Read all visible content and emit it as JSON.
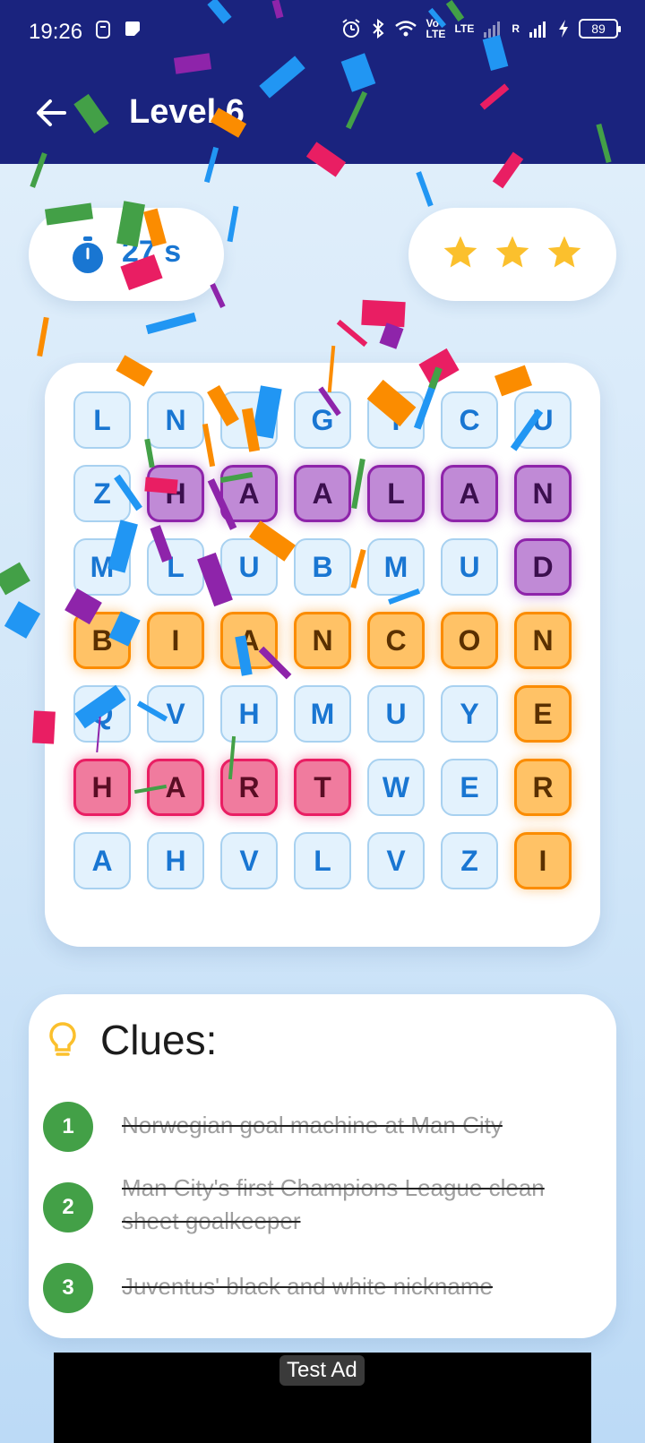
{
  "status_bar": {
    "time": "19:26",
    "network_label_1": "Vo LTE",
    "network_label_2": "LTE",
    "signal_label": "R",
    "battery": "89"
  },
  "header": {
    "title": "Level 6",
    "back_icon": "arrow-left-icon"
  },
  "timer": {
    "value": "27 s",
    "icon": "stopwatch-icon"
  },
  "rating": {
    "stars_earned": 3,
    "stars_total": 3,
    "star_color": "#fbc02d"
  },
  "grid": {
    "rows": [
      [
        "L",
        "N",
        "I",
        "G",
        "I",
        "C",
        "U"
      ],
      [
        "Z",
        "H",
        "A",
        "A",
        "L",
        "A",
        "N"
      ],
      [
        "M",
        "L",
        "U",
        "B",
        "M",
        "U",
        "D"
      ],
      [
        "B",
        "I",
        "A",
        "N",
        "C",
        "O",
        "N"
      ],
      [
        "Q",
        "V",
        "H",
        "M",
        "U",
        "Y",
        "E"
      ],
      [
        "H",
        "A",
        "R",
        "T",
        "W",
        "E",
        "R"
      ],
      [
        "A",
        "H",
        "V",
        "L",
        "V",
        "Z",
        "I"
      ]
    ],
    "highlights": [
      [
        "plain",
        "plain",
        "plain",
        "plain",
        "plain",
        "plain",
        "plain"
      ],
      [
        "plain",
        "purple",
        "purple",
        "purple",
        "purple",
        "purple",
        "purple"
      ],
      [
        "plain",
        "plain",
        "plain",
        "plain",
        "plain",
        "plain",
        "purple"
      ],
      [
        "orange",
        "orange",
        "orange",
        "orange",
        "orange",
        "orange",
        "orange"
      ],
      [
        "plain",
        "plain",
        "plain",
        "plain",
        "plain",
        "plain",
        "orange"
      ],
      [
        "pink",
        "pink",
        "pink",
        "pink",
        "plain",
        "plain",
        "orange"
      ],
      [
        "plain",
        "plain",
        "plain",
        "plain",
        "plain",
        "plain",
        "orange"
      ]
    ]
  },
  "clues": {
    "title": "Clues:",
    "icon": "lightbulb-icon",
    "items": [
      {
        "number": "1",
        "text": "Norwegian goal machine at Man City",
        "solved": true
      },
      {
        "number": "2",
        "text": "Man City's first Champions League clean sheet goalkeeper",
        "solved": true
      },
      {
        "number": "3",
        "text": "Juventus' black and white nickname",
        "solved": true
      }
    ]
  },
  "ad": {
    "label": "Test Ad"
  },
  "colors": {
    "appbar": "#1a237e",
    "accent_blue": "#1976d2",
    "purple": "#8e24aa",
    "orange": "#fb8c00",
    "pink": "#e91e63",
    "green": "#43a047"
  }
}
